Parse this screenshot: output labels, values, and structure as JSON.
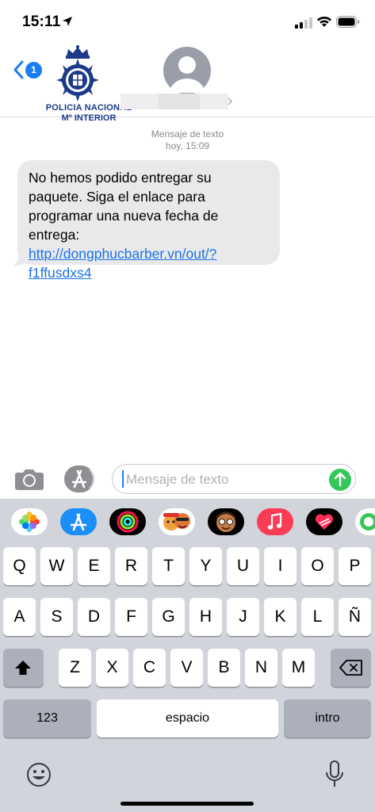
{
  "status_bar": {
    "time": "15:11"
  },
  "header": {
    "back_badge_count": "1",
    "logo_text_line1": "POLICIA NACIONAL",
    "logo_text_line2": "Mº INTERIOR"
  },
  "conversation": {
    "timestamp_line1": "Mensaje de texto",
    "timestamp_line2": "hoy, 15:09",
    "message_text": "No hemos podido entregar su paquete. Siga el enlace para programar una nueva fecha de entrega: ",
    "message_link_line1": "http://dongphucbarber.vn/",
    "message_link_line2": "out/?f1ffusdxs4"
  },
  "input_bar": {
    "placeholder": "Mensaje de texto"
  },
  "keyboard": {
    "row1": [
      "Q",
      "W",
      "E",
      "R",
      "T",
      "Y",
      "U",
      "I",
      "O",
      "P"
    ],
    "row2": [
      "A",
      "S",
      "D",
      "F",
      "G",
      "H",
      "J",
      "K",
      "L",
      "Ñ"
    ],
    "row3": [
      "Z",
      "X",
      "C",
      "V",
      "B",
      "N",
      "M"
    ],
    "numbers_label": "123",
    "space_label": "espacio",
    "return_label": "intro"
  },
  "colors": {
    "accent": "#1a7cf5",
    "link": "#1a73e8",
    "send": "#34c759",
    "bubble": "#e9e9eb",
    "keyboard_bg": "#d1d4db",
    "logo_blue": "#1d3a8a"
  },
  "icons": {
    "status": [
      "location-arrow-icon",
      "cellular-signal-icon",
      "wifi-icon",
      "battery-icon"
    ],
    "app_drawer": [
      "photos-app-icon",
      "app-store-app-icon",
      "activity-app-icon",
      "memoji-stickers-icon",
      "animoji-icon",
      "music-app-icon",
      "digital-touch-icon",
      "more-apps-icon"
    ],
    "keyboard": [
      "shift-icon",
      "delete-icon",
      "emoji-icon",
      "microphone-icon"
    ]
  }
}
